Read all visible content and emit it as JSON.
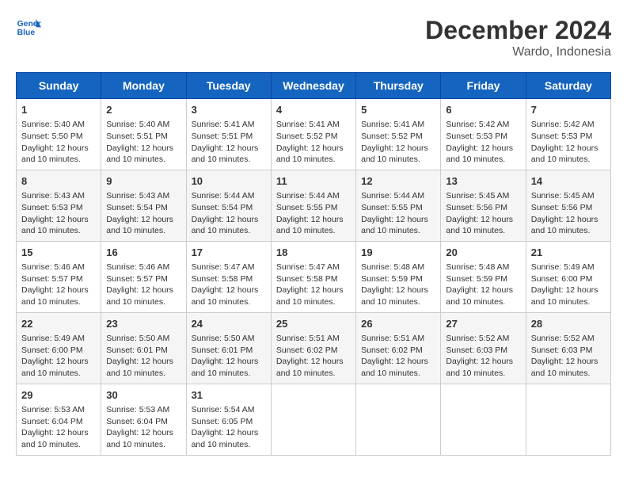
{
  "header": {
    "logo_line1": "General",
    "logo_line2": "Blue",
    "title": "December 2024",
    "subtitle": "Wardo, Indonesia"
  },
  "days_of_week": [
    "Sunday",
    "Monday",
    "Tuesday",
    "Wednesday",
    "Thursday",
    "Friday",
    "Saturday"
  ],
  "weeks": [
    [
      {
        "day": "1",
        "sunrise": "5:40 AM",
        "sunset": "5:50 PM",
        "daylight": "12 hours and 10 minutes."
      },
      {
        "day": "2",
        "sunrise": "5:40 AM",
        "sunset": "5:51 PM",
        "daylight": "12 hours and 10 minutes."
      },
      {
        "day": "3",
        "sunrise": "5:41 AM",
        "sunset": "5:51 PM",
        "daylight": "12 hours and 10 minutes."
      },
      {
        "day": "4",
        "sunrise": "5:41 AM",
        "sunset": "5:52 PM",
        "daylight": "12 hours and 10 minutes."
      },
      {
        "day": "5",
        "sunrise": "5:41 AM",
        "sunset": "5:52 PM",
        "daylight": "12 hours and 10 minutes."
      },
      {
        "day": "6",
        "sunrise": "5:42 AM",
        "sunset": "5:53 PM",
        "daylight": "12 hours and 10 minutes."
      },
      {
        "day": "7",
        "sunrise": "5:42 AM",
        "sunset": "5:53 PM",
        "daylight": "12 hours and 10 minutes."
      }
    ],
    [
      {
        "day": "8",
        "sunrise": "5:43 AM",
        "sunset": "5:53 PM",
        "daylight": "12 hours and 10 minutes."
      },
      {
        "day": "9",
        "sunrise": "5:43 AM",
        "sunset": "5:54 PM",
        "daylight": "12 hours and 10 minutes."
      },
      {
        "day": "10",
        "sunrise": "5:44 AM",
        "sunset": "5:54 PM",
        "daylight": "12 hours and 10 minutes."
      },
      {
        "day": "11",
        "sunrise": "5:44 AM",
        "sunset": "5:55 PM",
        "daylight": "12 hours and 10 minutes."
      },
      {
        "day": "12",
        "sunrise": "5:44 AM",
        "sunset": "5:55 PM",
        "daylight": "12 hours and 10 minutes."
      },
      {
        "day": "13",
        "sunrise": "5:45 AM",
        "sunset": "5:56 PM",
        "daylight": "12 hours and 10 minutes."
      },
      {
        "day": "14",
        "sunrise": "5:45 AM",
        "sunset": "5:56 PM",
        "daylight": "12 hours and 10 minutes."
      }
    ],
    [
      {
        "day": "15",
        "sunrise": "5:46 AM",
        "sunset": "5:57 PM",
        "daylight": "12 hours and 10 minutes."
      },
      {
        "day": "16",
        "sunrise": "5:46 AM",
        "sunset": "5:57 PM",
        "daylight": "12 hours and 10 minutes."
      },
      {
        "day": "17",
        "sunrise": "5:47 AM",
        "sunset": "5:58 PM",
        "daylight": "12 hours and 10 minutes."
      },
      {
        "day": "18",
        "sunrise": "5:47 AM",
        "sunset": "5:58 PM",
        "daylight": "12 hours and 10 minutes."
      },
      {
        "day": "19",
        "sunrise": "5:48 AM",
        "sunset": "5:59 PM",
        "daylight": "12 hours and 10 minutes."
      },
      {
        "day": "20",
        "sunrise": "5:48 AM",
        "sunset": "5:59 PM",
        "daylight": "12 hours and 10 minutes."
      },
      {
        "day": "21",
        "sunrise": "5:49 AM",
        "sunset": "6:00 PM",
        "daylight": "12 hours and 10 minutes."
      }
    ],
    [
      {
        "day": "22",
        "sunrise": "5:49 AM",
        "sunset": "6:00 PM",
        "daylight": "12 hours and 10 minutes."
      },
      {
        "day": "23",
        "sunrise": "5:50 AM",
        "sunset": "6:01 PM",
        "daylight": "12 hours and 10 minutes."
      },
      {
        "day": "24",
        "sunrise": "5:50 AM",
        "sunset": "6:01 PM",
        "daylight": "12 hours and 10 minutes."
      },
      {
        "day": "25",
        "sunrise": "5:51 AM",
        "sunset": "6:02 PM",
        "daylight": "12 hours and 10 minutes."
      },
      {
        "day": "26",
        "sunrise": "5:51 AM",
        "sunset": "6:02 PM",
        "daylight": "12 hours and 10 minutes."
      },
      {
        "day": "27",
        "sunrise": "5:52 AM",
        "sunset": "6:03 PM",
        "daylight": "12 hours and 10 minutes."
      },
      {
        "day": "28",
        "sunrise": "5:52 AM",
        "sunset": "6:03 PM",
        "daylight": "12 hours and 10 minutes."
      }
    ],
    [
      {
        "day": "29",
        "sunrise": "5:53 AM",
        "sunset": "6:04 PM",
        "daylight": "12 hours and 10 minutes."
      },
      {
        "day": "30",
        "sunrise": "5:53 AM",
        "sunset": "6:04 PM",
        "daylight": "12 hours and 10 minutes."
      },
      {
        "day": "31",
        "sunrise": "5:54 AM",
        "sunset": "6:05 PM",
        "daylight": "12 hours and 10 minutes."
      },
      null,
      null,
      null,
      null
    ]
  ]
}
